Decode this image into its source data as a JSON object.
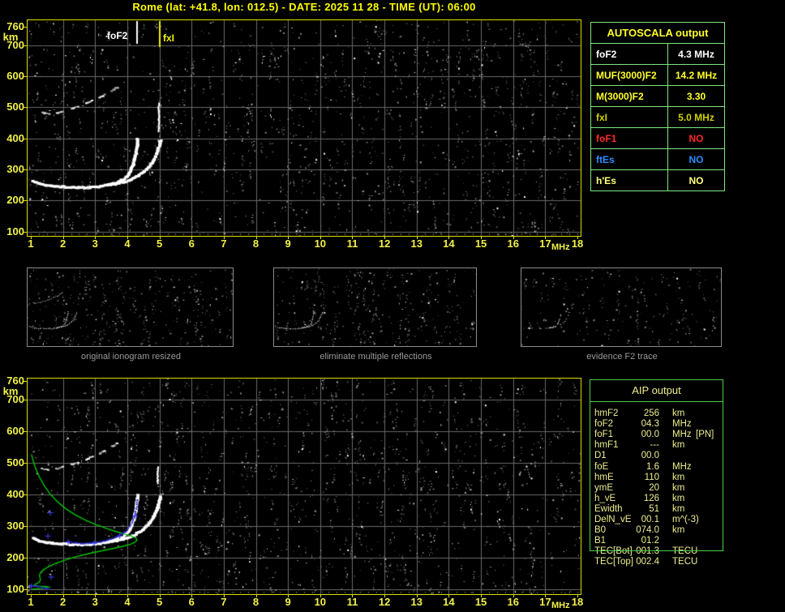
{
  "title": "Rome (lat: +41.8, lon: 012.5) - DATE: 2025 11 28 - TIME (UT): 06:00",
  "colors": {
    "title": "#FFFF00",
    "axis_labels": "#F2F24A",
    "plot_border": "#DCDC00",
    "grid": "#6A6A6A",
    "autoscala_border": "#7FE67F",
    "aip_border": "#4BD04B",
    "aip_text": "#EFEF90",
    "caption_gray": "#9A9A9A",
    "profile_green": "#00C800",
    "scaled_trace_blue": "#2626D4"
  },
  "autoscala_table": {
    "header": "AUTOSCALA output",
    "rows": [
      {
        "label": "foF2",
        "value": "4.3 MHz",
        "color": "#FFFFFF"
      },
      {
        "label": "MUF(3000)F2",
        "value": "14.2 MHz",
        "color": "#FFFF2A"
      },
      {
        "label": "M(3000)F2",
        "value": "3.30",
        "color": "#FFFF2A"
      },
      {
        "label": "fxI",
        "value": "5.0 MHz",
        "color": "#CFCF00"
      },
      {
        "label": "foF1",
        "value": "NO",
        "color": "#FF2A2A"
      },
      {
        "label": "ftEs",
        "value": "NO",
        "color": "#2E8CFF"
      },
      {
        "label": "h'Es",
        "value": "NO",
        "color": "#FFFF7A"
      }
    ]
  },
  "aip_table": {
    "header": "AIP output",
    "rows": [
      {
        "label": "hmF2",
        "value": "256",
        "unit": "km",
        "extra": ""
      },
      {
        "label": "foF2",
        "value": "04.3",
        "unit": "MHz",
        "extra": ""
      },
      {
        "label": "foF1",
        "value": "00.0",
        "unit": "MHz",
        "extra": "[PN]"
      },
      {
        "label": "hmF1",
        "value": "---",
        "unit": "km",
        "extra": ""
      },
      {
        "label": "D1",
        "value": "00.0",
        "unit": "",
        "extra": ""
      },
      {
        "label": "foE",
        "value": "1.6",
        "unit": "MHz",
        "extra": ""
      },
      {
        "label": "hmE",
        "value": "110",
        "unit": "km",
        "extra": ""
      },
      {
        "label": "ymE",
        "value": "20",
        "unit": "km",
        "extra": ""
      },
      {
        "label": "h_vE",
        "value": "126",
        "unit": "km",
        "extra": ""
      },
      {
        "label": "Ewidth",
        "value": "51",
        "unit": "km",
        "extra": ""
      },
      {
        "label": "DelN_vE",
        "value": "00.1",
        "unit": "m^(-3)",
        "extra": ""
      },
      {
        "label": "B0",
        "value": "074.0",
        "unit": "km",
        "extra": ""
      },
      {
        "label": "B1",
        "value": "01.2",
        "unit": "",
        "extra": ""
      },
      {
        "label": "TEC[Bot]",
        "value": "001.3",
        "unit": "TECU",
        "extra": ""
      },
      {
        "label": "TEC[Top]",
        "value": "002.4",
        "unit": "TECU",
        "extra": ""
      }
    ]
  },
  "thumbnails": [
    {
      "caption": "original ionogram resized"
    },
    {
      "caption": "eliminate multiple reflections"
    },
    {
      "caption": "evidence F2 trace"
    }
  ],
  "chart_data": [
    {
      "id": "top_ionogram",
      "type": "scatter",
      "title": "recorded ionogram with AUTOSCALA frequency markers",
      "xlabel": "MHz",
      "ylabel": "km",
      "xlim": [
        1,
        18
      ],
      "ylim": [
        100,
        760
      ],
      "xticks": [
        1,
        2,
        3,
        4,
        5,
        6,
        7,
        8,
        9,
        10,
        11,
        12,
        13,
        14,
        15,
        16,
        17,
        18
      ],
      "yticks": [
        760,
        700,
        600,
        500,
        400,
        300,
        200,
        100
      ],
      "grid": true,
      "annotations": [
        {
          "label": "foF2",
          "x_mhz": 4.3,
          "color": "#FFFFFF"
        },
        {
          "label": "fxI",
          "x_mhz": 5.0,
          "color": "#EFEF00"
        }
      ],
      "noise": {
        "seed": 11,
        "runs": 450,
        "singles": 900
      },
      "series": [
        {
          "name": "F2 trace O-mode",
          "color": "#FFFFFF",
          "style": "dotted-thick",
          "points": [
            [
              1.05,
              263
            ],
            [
              1.2,
              256
            ],
            [
              1.45,
              250
            ],
            [
              1.8,
              246
            ],
            [
              2.2,
              243
            ],
            [
              2.6,
              242
            ],
            [
              3.0,
              244
            ],
            [
              3.3,
              249
            ],
            [
              3.6,
              257
            ],
            [
              3.85,
              268
            ],
            [
              4.0,
              282
            ],
            [
              4.1,
              300
            ],
            [
              4.18,
              322
            ],
            [
              4.24,
              347
            ],
            [
              4.28,
              374
            ],
            [
              4.3,
              398
            ]
          ]
        },
        {
          "name": "F2 trace X-mode",
          "color": "#FFFFFF",
          "style": "dotted-thick",
          "points": [
            [
              3.35,
              250
            ],
            [
              3.6,
              254
            ],
            [
              3.9,
              261
            ],
            [
              4.2,
              273
            ],
            [
              4.45,
              289
            ],
            [
              4.65,
              309
            ],
            [
              4.8,
              331
            ],
            [
              4.9,
              353
            ],
            [
              4.97,
              375
            ],
            [
              5.01,
              393
            ]
          ]
        },
        {
          "name": "second-hop multiple reflection",
          "color": "#C8C8C8",
          "style": "dashed",
          "points": [
            [
              1.35,
              482
            ],
            [
              1.55,
              478
            ],
            [
              1.8,
              481
            ],
            [
              2.05,
              488
            ],
            [
              2.3,
              496
            ],
            [
              2.55,
              505
            ],
            [
              2.8,
              515
            ],
            [
              3.05,
              527
            ],
            [
              3.3,
              540
            ],
            [
              3.5,
              552
            ],
            [
              3.68,
              563
            ],
            [
              3.85,
              574
            ]
          ]
        },
        {
          "name": "interference streak",
          "color": "#FFFFFF",
          "style": "vstreak",
          "points": [
            [
              4.98,
              425
            ],
            [
              4.98,
              512
            ]
          ]
        }
      ]
    },
    {
      "id": "bottom_ionogram",
      "type": "scatter",
      "title": "ionogram with restored trace and electron density profile",
      "xlabel": "MHz",
      "ylabel": "km",
      "xlim": [
        1,
        18
      ],
      "ylim": [
        100,
        760
      ],
      "xticks": [
        1,
        2,
        3,
        4,
        5,
        6,
        7,
        8,
        9,
        10,
        11,
        12,
        13,
        14,
        15,
        16,
        17,
        18
      ],
      "yticks": [
        760,
        700,
        600,
        500,
        400,
        300,
        200,
        100
      ],
      "grid": true,
      "annotations": [],
      "noise": {
        "seed": 29,
        "runs": 450,
        "singles": 900
      },
      "series": [
        {
          "name": "F2 trace O-mode",
          "color": "#FFFFFF",
          "style": "dotted-thick",
          "points": [
            [
              1.05,
              263
            ],
            [
              1.2,
              256
            ],
            [
              1.45,
              250
            ],
            [
              1.8,
              246
            ],
            [
              2.2,
              243
            ],
            [
              2.6,
              242
            ],
            [
              3.0,
              244
            ],
            [
              3.3,
              249
            ],
            [
              3.6,
              257
            ],
            [
              3.85,
              268
            ],
            [
              4.0,
              282
            ],
            [
              4.1,
              300
            ],
            [
              4.18,
              322
            ],
            [
              4.24,
              347
            ],
            [
              4.28,
              374
            ],
            [
              4.3,
              398
            ]
          ]
        },
        {
          "name": "F2 trace X-mode",
          "color": "#FFFFFF",
          "style": "dotted-thick",
          "points": [
            [
              3.35,
              250
            ],
            [
              3.6,
              254
            ],
            [
              3.9,
              261
            ],
            [
              4.2,
              273
            ],
            [
              4.45,
              289
            ],
            [
              4.65,
              309
            ],
            [
              4.8,
              331
            ],
            [
              4.9,
              353
            ],
            [
              4.97,
              375
            ],
            [
              5.01,
              393
            ]
          ]
        },
        {
          "name": "second-hop multiple reflection",
          "color": "#C8C8C8",
          "style": "dashed",
          "points": [
            [
              1.35,
              482
            ],
            [
              1.55,
              478
            ],
            [
              1.8,
              481
            ],
            [
              2.05,
              488
            ],
            [
              2.3,
              496
            ],
            [
              2.55,
              505
            ],
            [
              2.8,
              515
            ],
            [
              3.05,
              527
            ],
            [
              3.3,
              540
            ],
            [
              3.5,
              552
            ],
            [
              3.68,
              563
            ],
            [
              3.85,
              574
            ]
          ]
        },
        {
          "name": "interference streak",
          "color": "#FFFFFF",
          "style": "vstreak",
          "points": [
            [
              4.95,
              438
            ],
            [
              4.95,
              487
            ]
          ]
        },
        {
          "name": "electron density profile",
          "color": "#00C800",
          "style": "line",
          "points": [
            [
              1.02,
              528
            ],
            [
              1.07,
              508
            ],
            [
              1.15,
              483
            ],
            [
              1.27,
              455
            ],
            [
              1.42,
              428
            ],
            [
              1.6,
              402
            ],
            [
              1.82,
              378
            ],
            [
              2.08,
              356
            ],
            [
              2.38,
              336
            ],
            [
              2.7,
              319
            ],
            [
              3.02,
              305
            ],
            [
              3.35,
              293
            ],
            [
              3.65,
              283
            ],
            [
              3.92,
              275
            ],
            [
              4.15,
              268
            ],
            [
              4.28,
              262
            ],
            [
              4.3,
              256
            ],
            [
              4.24,
              249
            ],
            [
              4.1,
              243
            ],
            [
              3.85,
              236
            ],
            [
              3.55,
              229
            ],
            [
              3.2,
              222
            ],
            [
              2.8,
              213
            ],
            [
              2.4,
              203
            ],
            [
              2.05,
              192
            ],
            [
              1.75,
              181
            ],
            [
              1.52,
              170
            ],
            [
              1.37,
              160
            ],
            [
              1.3,
              152
            ],
            [
              1.27,
              145
            ],
            [
              1.28,
              138
            ],
            [
              1.3,
              131
            ],
            [
              1.28,
              125
            ],
            [
              1.22,
              120
            ],
            [
              1.14,
              116
            ],
            [
              1.1,
              112
            ],
            [
              1.25,
              110
            ],
            [
              1.45,
              109
            ],
            [
              1.55,
              107
            ],
            [
              1.35,
              103
            ],
            [
              1.15,
              101
            ],
            [
              1.03,
              100
            ]
          ]
        },
        {
          "name": "autoscaled F2 trace",
          "color": "#2626D4",
          "style": "blue-dots",
          "points": [
            [
              2.15,
              251
            ],
            [
              2.35,
              247
            ],
            [
              2.6,
              245
            ],
            [
              2.9,
              246
            ],
            [
              3.2,
              251
            ],
            [
              3.5,
              259
            ],
            [
              3.75,
              270
            ],
            [
              3.95,
              283
            ],
            [
              4.08,
              299
            ],
            [
              4.18,
              318
            ],
            [
              4.25,
              340
            ],
            [
              4.29,
              361
            ],
            [
              4.31,
              382
            ]
          ]
        },
        {
          "name": "autoscaled E trace",
          "color": "#2626D4",
          "style": "blue-dots",
          "points": [
            [
              1.0,
              111
            ],
            [
              1.12,
              110
            ],
            [
              1.26,
              108
            ],
            [
              1.4,
              105
            ],
            [
              1.5,
              102
            ],
            [
              1.56,
              100
            ]
          ]
        },
        {
          "name": "stray scaled points",
          "color": "#4040FF",
          "style": "blue-cross",
          "points": [
            [
              1.6,
              344
            ],
            [
              1.52,
              270
            ],
            [
              1.62,
              140
            ]
          ]
        }
      ]
    }
  ]
}
